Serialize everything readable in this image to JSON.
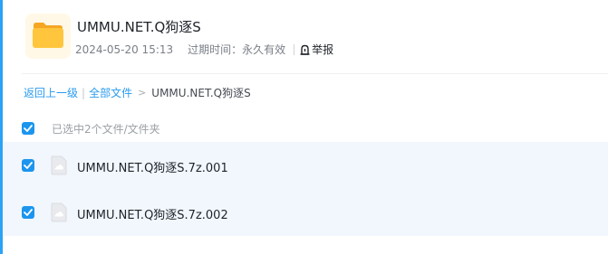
{
  "header": {
    "folder_icon": "folder-icon",
    "title": "UMMU.NET.Q狗逐S",
    "date": "2024-05-20 15:13",
    "expire_label": "过期时间：永久有效",
    "report_label": "举报",
    "report_icon": "report-flag-icon"
  },
  "breadcrumb": {
    "back_label": "返回上一级",
    "separator": "|",
    "all_files_label": "全部文件",
    "chevron": ">",
    "current": "UMMU.NET.Q狗逐S"
  },
  "selection": {
    "checked": true,
    "label": "已选中2个文件/文件夹"
  },
  "files": [
    {
      "name": "UMMU.NET.Q狗逐S.7z.001",
      "checked": true,
      "icon": "file-archive-icon"
    },
    {
      "name": "UMMU.NET.Q狗逐S.7z.002",
      "checked": true,
      "icon": "file-archive-icon"
    }
  ],
  "colors": {
    "accent": "#1c95ee",
    "link": "#2a9bee",
    "row_bg": "#f1f7fd",
    "folder": "#ffc53d"
  }
}
